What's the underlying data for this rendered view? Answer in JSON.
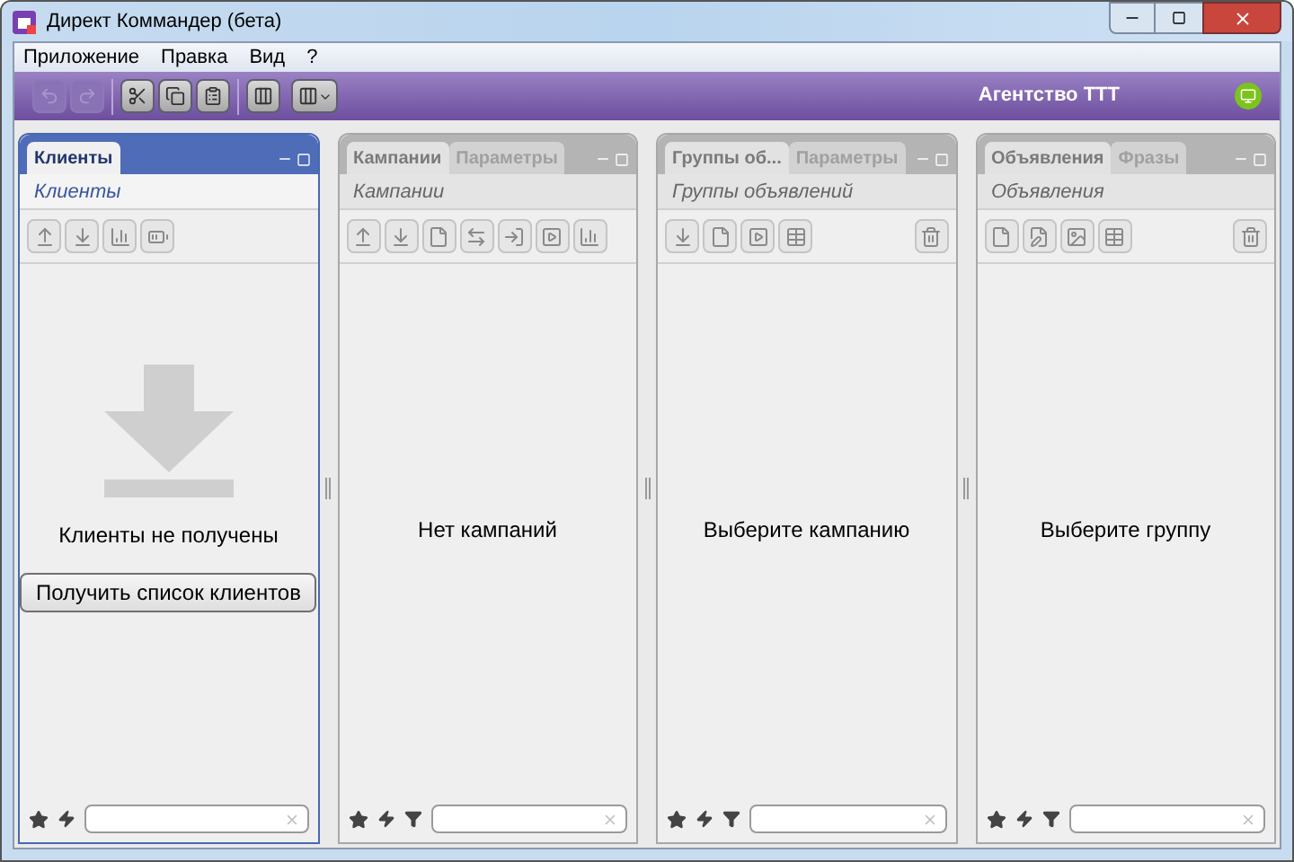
{
  "window": {
    "title": "Директ Коммандер (бета)"
  },
  "menu": [
    "Приложение",
    "Правка",
    "Вид",
    "?"
  ],
  "toolbar": [
    {
      "kind": "undo",
      "disabled": true
    },
    {
      "kind": "redo",
      "disabled": true
    },
    {
      "kind": "cut",
      "disabled": false
    },
    {
      "kind": "copy",
      "disabled": false
    },
    {
      "kind": "paste",
      "disabled": false
    },
    {
      "kind": "columns",
      "disabled": false
    },
    {
      "kind": "layout",
      "disabled": false
    }
  ],
  "account": {
    "name": "Агентство ТТТ",
    "online": true
  },
  "panels": [
    {
      "active": true,
      "tabs": [
        {
          "label": "Клиенты",
          "selected": true
        }
      ],
      "subtitle": "Клиенты",
      "tools": [
        {
          "kind": "upload"
        },
        {
          "kind": "download"
        },
        {
          "kind": "chart"
        },
        {
          "kind": "battery"
        }
      ],
      "message": "Клиенты не получены",
      "big_icon": true,
      "action": "Получить список клиентов",
      "filter": false
    },
    {
      "active": false,
      "tabs": [
        {
          "label": "Кампании",
          "selected": true
        },
        {
          "label": "Параметры",
          "selected": false
        }
      ],
      "subtitle": "Кампании",
      "tools": [
        {
          "kind": "upload"
        },
        {
          "kind": "download"
        },
        {
          "kind": "file"
        },
        {
          "kind": "swap"
        },
        {
          "kind": "enter"
        },
        {
          "kind": "play"
        },
        {
          "kind": "chart"
        }
      ],
      "message": "Нет кампаний",
      "big_icon": false,
      "filter": true
    },
    {
      "active": false,
      "tabs": [
        {
          "label": "Группы об...",
          "selected": true
        },
        {
          "label": "Параметры",
          "selected": false
        }
      ],
      "subtitle": "Группы объявлений",
      "tools": [
        {
          "kind": "download"
        },
        {
          "kind": "file"
        },
        {
          "kind": "play"
        },
        {
          "kind": "table"
        },
        {
          "kind": "trash"
        }
      ],
      "message": "Выберите кампанию",
      "big_icon": false,
      "filter": true
    },
    {
      "active": false,
      "tabs": [
        {
          "label": "Объявления",
          "selected": true
        },
        {
          "label": "Фразы",
          "selected": false
        }
      ],
      "subtitle": "Объявления",
      "tools": [
        {
          "kind": "file"
        },
        {
          "kind": "edit"
        },
        {
          "kind": "image"
        },
        {
          "kind": "table"
        },
        {
          "kind": "trash"
        }
      ],
      "message": "Выберите группу",
      "big_icon": false,
      "filter": true
    }
  ]
}
